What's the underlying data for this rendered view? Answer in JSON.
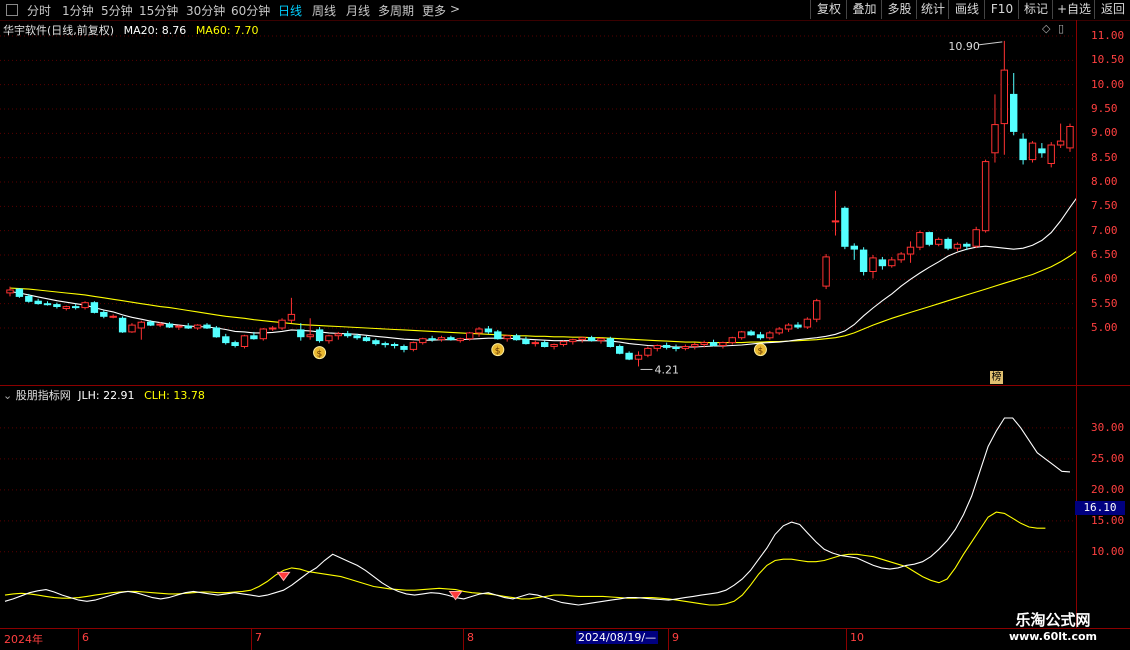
{
  "toolbar": {
    "periods": [
      "分时",
      "1分钟",
      "5分钟",
      "15分钟",
      "30分钟",
      "60分钟",
      "日线",
      "周线",
      "月线",
      "多周期",
      "更多"
    ],
    "active_period": "日线",
    "more_arrow": ">",
    "right_buttons": [
      "复权",
      "叠加",
      "多股",
      "统计",
      "画线",
      "F10",
      "标记",
      "+自选",
      "返回"
    ]
  },
  "main_chart": {
    "title": "华宇软件(日线,前复权)",
    "ma20_label": "MA20: 8.76",
    "ma60_label": "MA60: 7.70",
    "high_marker": "10.90",
    "low_marker": "4.21",
    "rank_badge": "榜",
    "y_ticks": [
      "11.00",
      "10.50",
      "10.00",
      "9.50",
      "9.00",
      "8.50",
      "8.00",
      "7.50",
      "7.00",
      "6.50",
      "6.00",
      "5.50",
      "5.00"
    ],
    "colors": {
      "up": "#ff3232",
      "down": "#54ffff",
      "ma20": "#ffffff",
      "ma60": "#ffff00"
    }
  },
  "indicator": {
    "title": "股朋指标网",
    "jlh_label": "JLH: 22.91",
    "clh_label": "CLH: 13.78",
    "y_ticks": [
      "30.00",
      "25.00",
      "20.00",
      "15.00",
      "10.00"
    ],
    "current_value": "16.10"
  },
  "timeline": {
    "labels": [
      "2024年",
      "6",
      "7",
      "8",
      "9",
      "10"
    ],
    "cursor_date": "2024/08/19/—"
  },
  "watermark": {
    "line1": "乐淘公式网",
    "line2": "www.60lt.com"
  },
  "chart_data": {
    "type": "candlestick",
    "ylim": [
      4.0,
      11.2
    ],
    "candles": [
      {
        "o": 5.72,
        "h": 5.85,
        "l": 5.65,
        "c": 5.78
      },
      {
        "o": 5.8,
        "h": 5.82,
        "l": 5.62,
        "c": 5.65
      },
      {
        "o": 5.65,
        "h": 5.7,
        "l": 5.52,
        "c": 5.55
      },
      {
        "o": 5.55,
        "h": 5.6,
        "l": 5.48,
        "c": 5.5
      },
      {
        "o": 5.5,
        "h": 5.55,
        "l": 5.46,
        "c": 5.48
      },
      {
        "o": 5.48,
        "h": 5.52,
        "l": 5.4,
        "c": 5.44
      },
      {
        "o": 5.4,
        "h": 5.46,
        "l": 5.36,
        "c": 5.44
      },
      {
        "o": 5.44,
        "h": 5.5,
        "l": 5.38,
        "c": 5.42
      },
      {
        "o": 5.42,
        "h": 5.55,
        "l": 5.38,
        "c": 5.52
      },
      {
        "o": 5.52,
        "h": 5.55,
        "l": 5.3,
        "c": 5.32
      },
      {
        "o": 5.32,
        "h": 5.36,
        "l": 5.2,
        "c": 5.24
      },
      {
        "o": 5.24,
        "h": 5.28,
        "l": 5.2,
        "c": 5.24
      },
      {
        "o": 5.2,
        "h": 5.24,
        "l": 4.9,
        "c": 4.92
      },
      {
        "o": 4.92,
        "h": 5.1,
        "l": 4.9,
        "c": 5.06
      },
      {
        "o": 5.0,
        "h": 5.15,
        "l": 4.76,
        "c": 5.12
      },
      {
        "o": 5.12,
        "h": 5.16,
        "l": 5.04,
        "c": 5.06
      },
      {
        "o": 5.06,
        "h": 5.12,
        "l": 5.02,
        "c": 5.08
      },
      {
        "o": 5.08,
        "h": 5.12,
        "l": 5.0,
        "c": 5.02
      },
      {
        "o": 5.02,
        "h": 5.06,
        "l": 4.96,
        "c": 5.04
      },
      {
        "o": 5.04,
        "h": 5.1,
        "l": 4.98,
        "c": 5.0
      },
      {
        "o": 5.0,
        "h": 5.08,
        "l": 4.96,
        "c": 5.06
      },
      {
        "o": 5.06,
        "h": 5.1,
        "l": 4.98,
        "c": 5.0
      },
      {
        "o": 5.0,
        "h": 5.04,
        "l": 4.8,
        "c": 4.82
      },
      {
        "o": 4.82,
        "h": 4.88,
        "l": 4.66,
        "c": 4.7
      },
      {
        "o": 4.7,
        "h": 4.74,
        "l": 4.6,
        "c": 4.64
      },
      {
        "o": 4.62,
        "h": 4.86,
        "l": 4.58,
        "c": 4.84
      },
      {
        "o": 4.84,
        "h": 4.92,
        "l": 4.76,
        "c": 4.78
      },
      {
        "o": 4.78,
        "h": 5.0,
        "l": 4.74,
        "c": 4.98
      },
      {
        "o": 4.98,
        "h": 5.04,
        "l": 4.94,
        "c": 5.0
      },
      {
        "o": 5.0,
        "h": 5.2,
        "l": 4.96,
        "c": 5.16
      },
      {
        "o": 5.16,
        "h": 5.62,
        "l": 5.1,
        "c": 5.28
      },
      {
        "o": 4.96,
        "h": 5.1,
        "l": 4.74,
        "c": 4.82
      },
      {
        "o": 4.82,
        "h": 5.2,
        "l": 4.76,
        "c": 4.86
      },
      {
        "o": 4.96,
        "h": 5.02,
        "l": 4.7,
        "c": 4.74
      },
      {
        "o": 4.74,
        "h": 4.86,
        "l": 4.68,
        "c": 4.84
      },
      {
        "o": 4.84,
        "h": 4.92,
        "l": 4.76,
        "c": 4.88
      },
      {
        "o": 4.88,
        "h": 4.94,
        "l": 4.8,
        "c": 4.84
      },
      {
        "o": 4.84,
        "h": 4.88,
        "l": 4.76,
        "c": 4.8
      },
      {
        "o": 4.8,
        "h": 4.84,
        "l": 4.72,
        "c": 4.74
      },
      {
        "o": 4.74,
        "h": 4.78,
        "l": 4.64,
        "c": 4.68
      },
      {
        "o": 4.68,
        "h": 4.72,
        "l": 4.6,
        "c": 4.66
      },
      {
        "o": 4.66,
        "h": 4.7,
        "l": 4.58,
        "c": 4.64
      },
      {
        "o": 4.62,
        "h": 4.66,
        "l": 4.5,
        "c": 4.56
      },
      {
        "o": 4.56,
        "h": 4.72,
        "l": 4.52,
        "c": 4.7
      },
      {
        "o": 4.7,
        "h": 4.8,
        "l": 4.66,
        "c": 4.78
      },
      {
        "o": 4.78,
        "h": 4.84,
        "l": 4.72,
        "c": 4.76
      },
      {
        "o": 4.76,
        "h": 4.84,
        "l": 4.72,
        "c": 4.8
      },
      {
        "o": 4.8,
        "h": 4.84,
        "l": 4.74,
        "c": 4.76
      },
      {
        "o": 4.74,
        "h": 4.8,
        "l": 4.7,
        "c": 4.78
      },
      {
        "o": 4.78,
        "h": 4.92,
        "l": 4.74,
        "c": 4.9
      },
      {
        "o": 4.9,
        "h": 5.02,
        "l": 4.82,
        "c": 4.98
      },
      {
        "o": 4.98,
        "h": 5.04,
        "l": 4.88,
        "c": 4.92
      },
      {
        "o": 4.92,
        "h": 4.96,
        "l": 4.76,
        "c": 4.78
      },
      {
        "o": 4.78,
        "h": 4.86,
        "l": 4.72,
        "c": 4.84
      },
      {
        "o": 4.84,
        "h": 4.88,
        "l": 4.74,
        "c": 4.76
      },
      {
        "o": 4.76,
        "h": 4.82,
        "l": 4.66,
        "c": 4.68
      },
      {
        "o": 4.68,
        "h": 4.74,
        "l": 4.62,
        "c": 4.7
      },
      {
        "o": 4.7,
        "h": 4.74,
        "l": 4.6,
        "c": 4.62
      },
      {
        "o": 4.62,
        "h": 4.68,
        "l": 4.56,
        "c": 4.66
      },
      {
        "o": 4.66,
        "h": 4.74,
        "l": 4.62,
        "c": 4.72
      },
      {
        "o": 4.72,
        "h": 4.78,
        "l": 4.66,
        "c": 4.76
      },
      {
        "o": 4.76,
        "h": 4.82,
        "l": 4.7,
        "c": 4.8
      },
      {
        "o": 4.8,
        "h": 4.84,
        "l": 4.72,
        "c": 4.74
      },
      {
        "o": 4.74,
        "h": 4.8,
        "l": 4.68,
        "c": 4.78
      },
      {
        "o": 4.78,
        "h": 4.82,
        "l": 4.6,
        "c": 4.62
      },
      {
        "o": 4.62,
        "h": 4.66,
        "l": 4.46,
        "c": 4.48
      },
      {
        "o": 4.48,
        "h": 4.52,
        "l": 4.34,
        "c": 4.36
      },
      {
        "o": 4.36,
        "h": 4.52,
        "l": 4.21,
        "c": 4.44
      },
      {
        "o": 4.44,
        "h": 4.62,
        "l": 4.4,
        "c": 4.58
      },
      {
        "o": 4.58,
        "h": 4.66,
        "l": 4.52,
        "c": 4.64
      },
      {
        "o": 4.64,
        "h": 4.7,
        "l": 4.56,
        "c": 4.6
      },
      {
        "o": 4.6,
        "h": 4.66,
        "l": 4.52,
        "c": 4.58
      },
      {
        "o": 4.58,
        "h": 4.66,
        "l": 4.54,
        "c": 4.62
      },
      {
        "o": 4.62,
        "h": 4.7,
        "l": 4.56,
        "c": 4.66
      },
      {
        "o": 4.66,
        "h": 4.74,
        "l": 4.6,
        "c": 4.7
      },
      {
        "o": 4.7,
        "h": 4.76,
        "l": 4.62,
        "c": 4.64
      },
      {
        "o": 4.64,
        "h": 4.72,
        "l": 4.58,
        "c": 4.7
      },
      {
        "o": 4.7,
        "h": 4.82,
        "l": 4.66,
        "c": 4.8
      },
      {
        "o": 4.8,
        "h": 4.94,
        "l": 4.76,
        "c": 4.92
      },
      {
        "o": 4.92,
        "h": 4.96,
        "l": 4.84,
        "c": 4.86
      },
      {
        "o": 4.86,
        "h": 4.92,
        "l": 4.76,
        "c": 4.8
      },
      {
        "o": 4.8,
        "h": 4.94,
        "l": 4.76,
        "c": 4.9
      },
      {
        "o": 4.9,
        "h": 5.02,
        "l": 4.86,
        "c": 4.98
      },
      {
        "o": 4.98,
        "h": 5.1,
        "l": 4.92,
        "c": 5.06
      },
      {
        "o": 5.06,
        "h": 5.12,
        "l": 4.98,
        "c": 5.02
      },
      {
        "o": 5.02,
        "h": 5.22,
        "l": 4.98,
        "c": 5.18
      },
      {
        "o": 5.18,
        "h": 5.6,
        "l": 5.12,
        "c": 5.56
      },
      {
        "o": 5.86,
        "h": 6.52,
        "l": 5.8,
        "c": 6.46
      },
      {
        "o": 7.2,
        "h": 7.82,
        "l": 6.9,
        "c": 7.2
      },
      {
        "o": 7.46,
        "h": 7.5,
        "l": 6.62,
        "c": 6.68
      },
      {
        "o": 6.68,
        "h": 6.74,
        "l": 6.4,
        "c": 6.62
      },
      {
        "o": 6.6,
        "h": 6.66,
        "l": 6.08,
        "c": 6.16
      },
      {
        "o": 6.16,
        "h": 6.5,
        "l": 6.02,
        "c": 6.44
      },
      {
        "o": 6.4,
        "h": 6.46,
        "l": 6.2,
        "c": 6.28
      },
      {
        "o": 6.28,
        "h": 6.46,
        "l": 6.24,
        "c": 6.4
      },
      {
        "o": 6.4,
        "h": 6.56,
        "l": 6.34,
        "c": 6.52
      },
      {
        "o": 6.52,
        "h": 6.78,
        "l": 6.34,
        "c": 6.66
      },
      {
        "o": 6.66,
        "h": 7.0,
        "l": 6.6,
        "c": 6.96
      },
      {
        "o": 6.96,
        "h": 6.98,
        "l": 6.68,
        "c": 6.72
      },
      {
        "o": 6.72,
        "h": 6.86,
        "l": 6.68,
        "c": 6.82
      },
      {
        "o": 6.82,
        "h": 6.86,
        "l": 6.6,
        "c": 6.64
      },
      {
        "o": 6.64,
        "h": 6.76,
        "l": 6.58,
        "c": 6.72
      },
      {
        "o": 6.72,
        "h": 6.76,
        "l": 6.6,
        "c": 6.68
      },
      {
        "o": 6.68,
        "h": 7.08,
        "l": 6.64,
        "c": 7.02
      },
      {
        "o": 7.0,
        "h": 8.46,
        "l": 6.96,
        "c": 8.42
      },
      {
        "o": 8.6,
        "h": 9.8,
        "l": 8.4,
        "c": 9.18
      },
      {
        "o": 9.2,
        "h": 10.9,
        "l": 8.56,
        "c": 10.3
      },
      {
        "o": 9.8,
        "h": 10.24,
        "l": 8.96,
        "c": 9.04
      },
      {
        "o": 8.88,
        "h": 9.0,
        "l": 8.36,
        "c": 8.46
      },
      {
        "o": 8.46,
        "h": 8.84,
        "l": 8.4,
        "c": 8.8
      },
      {
        "o": 8.68,
        "h": 8.8,
        "l": 8.5,
        "c": 8.6
      },
      {
        "o": 8.38,
        "h": 8.82,
        "l": 8.3,
        "c": 8.76
      },
      {
        "o": 8.76,
        "h": 9.2,
        "l": 8.7,
        "c": 8.84
      },
      {
        "o": 8.7,
        "h": 9.2,
        "l": 8.62,
        "c": 9.14
      }
    ],
    "ma20": [
      5.75,
      5.72,
      5.68,
      5.64,
      5.6,
      5.56,
      5.53,
      5.5,
      5.47,
      5.42,
      5.37,
      5.33,
      5.27,
      5.22,
      5.18,
      5.14,
      5.11,
      5.08,
      5.06,
      5.04,
      5.03,
      5.02,
      5.0,
      4.97,
      4.93,
      4.92,
      4.9,
      4.9,
      4.91,
      4.93,
      4.96,
      4.95,
      4.94,
      4.92,
      4.9,
      4.89,
      4.88,
      4.87,
      4.85,
      4.83,
      4.81,
      4.79,
      4.77,
      4.76,
      4.75,
      4.75,
      4.76,
      4.76,
      4.76,
      4.77,
      4.78,
      4.79,
      4.79,
      4.79,
      4.78,
      4.77,
      4.76,
      4.75,
      4.74,
      4.74,
      4.74,
      4.74,
      4.74,
      4.74,
      4.73,
      4.71,
      4.68,
      4.66,
      4.64,
      4.63,
      4.62,
      4.61,
      4.61,
      4.61,
      4.62,
      4.63,
      4.63,
      4.64,
      4.65,
      4.67,
      4.69,
      4.7,
      4.71,
      4.73,
      4.76,
      4.78,
      4.8,
      4.83,
      4.87,
      4.94,
      5.07,
      5.25,
      5.41,
      5.56,
      5.7,
      5.86,
      6.0,
      6.13,
      6.25,
      6.36,
      6.48,
      6.56,
      6.62,
      6.66,
      6.68,
      6.66,
      6.64,
      6.62,
      6.64,
      6.7,
      6.8,
      6.96,
      7.2,
      7.48,
      7.75,
      8.0,
      8.26,
      8.5,
      8.66,
      8.82,
      8.92,
      8.96,
      9.0,
      8.96,
      8.9,
      8.86,
      8.82,
      8.78,
      8.76
    ],
    "ma60": [
      5.82,
      5.81,
      5.8,
      5.78,
      5.76,
      5.74,
      5.72,
      5.7,
      5.68,
      5.65,
      5.62,
      5.59,
      5.56,
      5.53,
      5.5,
      5.47,
      5.44,
      5.42,
      5.39,
      5.36,
      5.33,
      5.3,
      5.27,
      5.24,
      5.22,
      5.2,
      5.17,
      5.15,
      5.13,
      5.11,
      5.09,
      5.07,
      5.06,
      5.05,
      5.04,
      5.03,
      5.02,
      5.01,
      5.0,
      4.99,
      4.98,
      4.97,
      4.96,
      4.95,
      4.94,
      4.93,
      4.92,
      4.91,
      4.9,
      4.89,
      4.88,
      4.87,
      4.86,
      4.85,
      4.84,
      4.84,
      4.83,
      4.83,
      4.82,
      4.82,
      4.81,
      4.81,
      4.8,
      4.8,
      4.79,
      4.78,
      4.77,
      4.76,
      4.75,
      4.74,
      4.73,
      4.72,
      4.71,
      4.71,
      4.7,
      4.7,
      4.7,
      4.7,
      4.7,
      4.71,
      4.71,
      4.72,
      4.72,
      4.73,
      4.74,
      4.75,
      4.76,
      4.78,
      4.8,
      4.84,
      4.9,
      4.98,
      5.06,
      5.13,
      5.2,
      5.26,
      5.32,
      5.38,
      5.44,
      5.5,
      5.56,
      5.62,
      5.68,
      5.74,
      5.8,
      5.86,
      5.92,
      5.98,
      6.04,
      6.1,
      6.18,
      6.26,
      6.36,
      6.48,
      6.62,
      6.78,
      6.94,
      7.08,
      7.2,
      7.3,
      7.38,
      7.44,
      7.5,
      7.56,
      7.62,
      7.66,
      7.7
    ],
    "indicator": {
      "ylim": [
        0,
        34
      ],
      "jlh": [
        2.0,
        2.4,
        2.9,
        3.4,
        3.7,
        3.9,
        3.5,
        3.0,
        2.6,
        2.2,
        2.0,
        2.2,
        2.6,
        3.0,
        3.4,
        3.6,
        3.4,
        3.0,
        2.6,
        2.4,
        2.6,
        3.0,
        3.4,
        3.6,
        3.4,
        3.2,
        3.0,
        3.2,
        3.4,
        3.2,
        3.0,
        2.8,
        3.0,
        3.4,
        3.8,
        4.6,
        5.6,
        6.6,
        7.4,
        8.6,
        9.6,
        9.0,
        8.4,
        7.8,
        7.0,
        6.0,
        5.0,
        4.2,
        3.6,
        3.2,
        3.0,
        3.2,
        3.4,
        3.3,
        3.0,
        2.6,
        2.4,
        2.8,
        3.2,
        3.4,
        3.0,
        2.6,
        2.4,
        2.8,
        3.2,
        3.0,
        2.6,
        2.2,
        1.8,
        1.6,
        1.4,
        1.6,
        1.8,
        2.0,
        2.2,
        2.4,
        2.6,
        2.6,
        2.5,
        2.4,
        2.3,
        2.2,
        2.4,
        2.6,
        2.8,
        3.0,
        3.2,
        3.4,
        3.8,
        4.6,
        5.6,
        7.0,
        8.8,
        10.6,
        12.8,
        14.2,
        14.8,
        14.4,
        13.0,
        11.6,
        10.4,
        9.8,
        9.4,
        9.2,
        9.0,
        8.4,
        7.8,
        7.4,
        7.2,
        7.4,
        7.8,
        8.0,
        8.4,
        9.2,
        10.4,
        11.8,
        13.6,
        16.0,
        19.0,
        23.0,
        27.0,
        29.5,
        31.6,
        31.6,
        30.0,
        28.0,
        26.0,
        25.0,
        24.0,
        23.0,
        22.9
      ],
      "clh": [
        3.0,
        3.2,
        3.3,
        3.2,
        3.0,
        2.8,
        2.6,
        2.5,
        2.5,
        2.6,
        2.8,
        3.0,
        3.2,
        3.4,
        3.5,
        3.6,
        3.6,
        3.5,
        3.4,
        3.3,
        3.2,
        3.2,
        3.3,
        3.4,
        3.5,
        3.5,
        3.4,
        3.4,
        3.5,
        3.6,
        3.8,
        4.4,
        5.2,
        6.2,
        7.0,
        7.4,
        7.2,
        6.8,
        6.6,
        6.4,
        6.2,
        6.0,
        5.6,
        5.2,
        4.8,
        4.4,
        4.2,
        4.0,
        3.9,
        3.8,
        3.8,
        3.9,
        4.0,
        4.1,
        4.0,
        3.9,
        3.6,
        3.4,
        3.3,
        3.2,
        3.0,
        2.8,
        2.6,
        2.4,
        2.4,
        2.6,
        2.8,
        3.0,
        3.0,
        2.9,
        2.8,
        2.8,
        2.8,
        2.8,
        2.7,
        2.6,
        2.5,
        2.5,
        2.6,
        2.6,
        2.5,
        2.4,
        2.2,
        2.0,
        1.8,
        1.6,
        1.4,
        1.4,
        1.6,
        2.0,
        3.0,
        4.6,
        6.4,
        7.8,
        8.6,
        8.8,
        8.8,
        8.6,
        8.4,
        8.4,
        8.6,
        9.0,
        9.4,
        9.6,
        9.6,
        9.4,
        9.2,
        8.8,
        8.4,
        8.0,
        7.6,
        6.8,
        6.0,
        5.4,
        5.0,
        5.6,
        7.4,
        9.6,
        11.6,
        13.6,
        15.6,
        16.4,
        16.2,
        15.4,
        14.6,
        14.0,
        13.8,
        13.8
      ]
    }
  }
}
